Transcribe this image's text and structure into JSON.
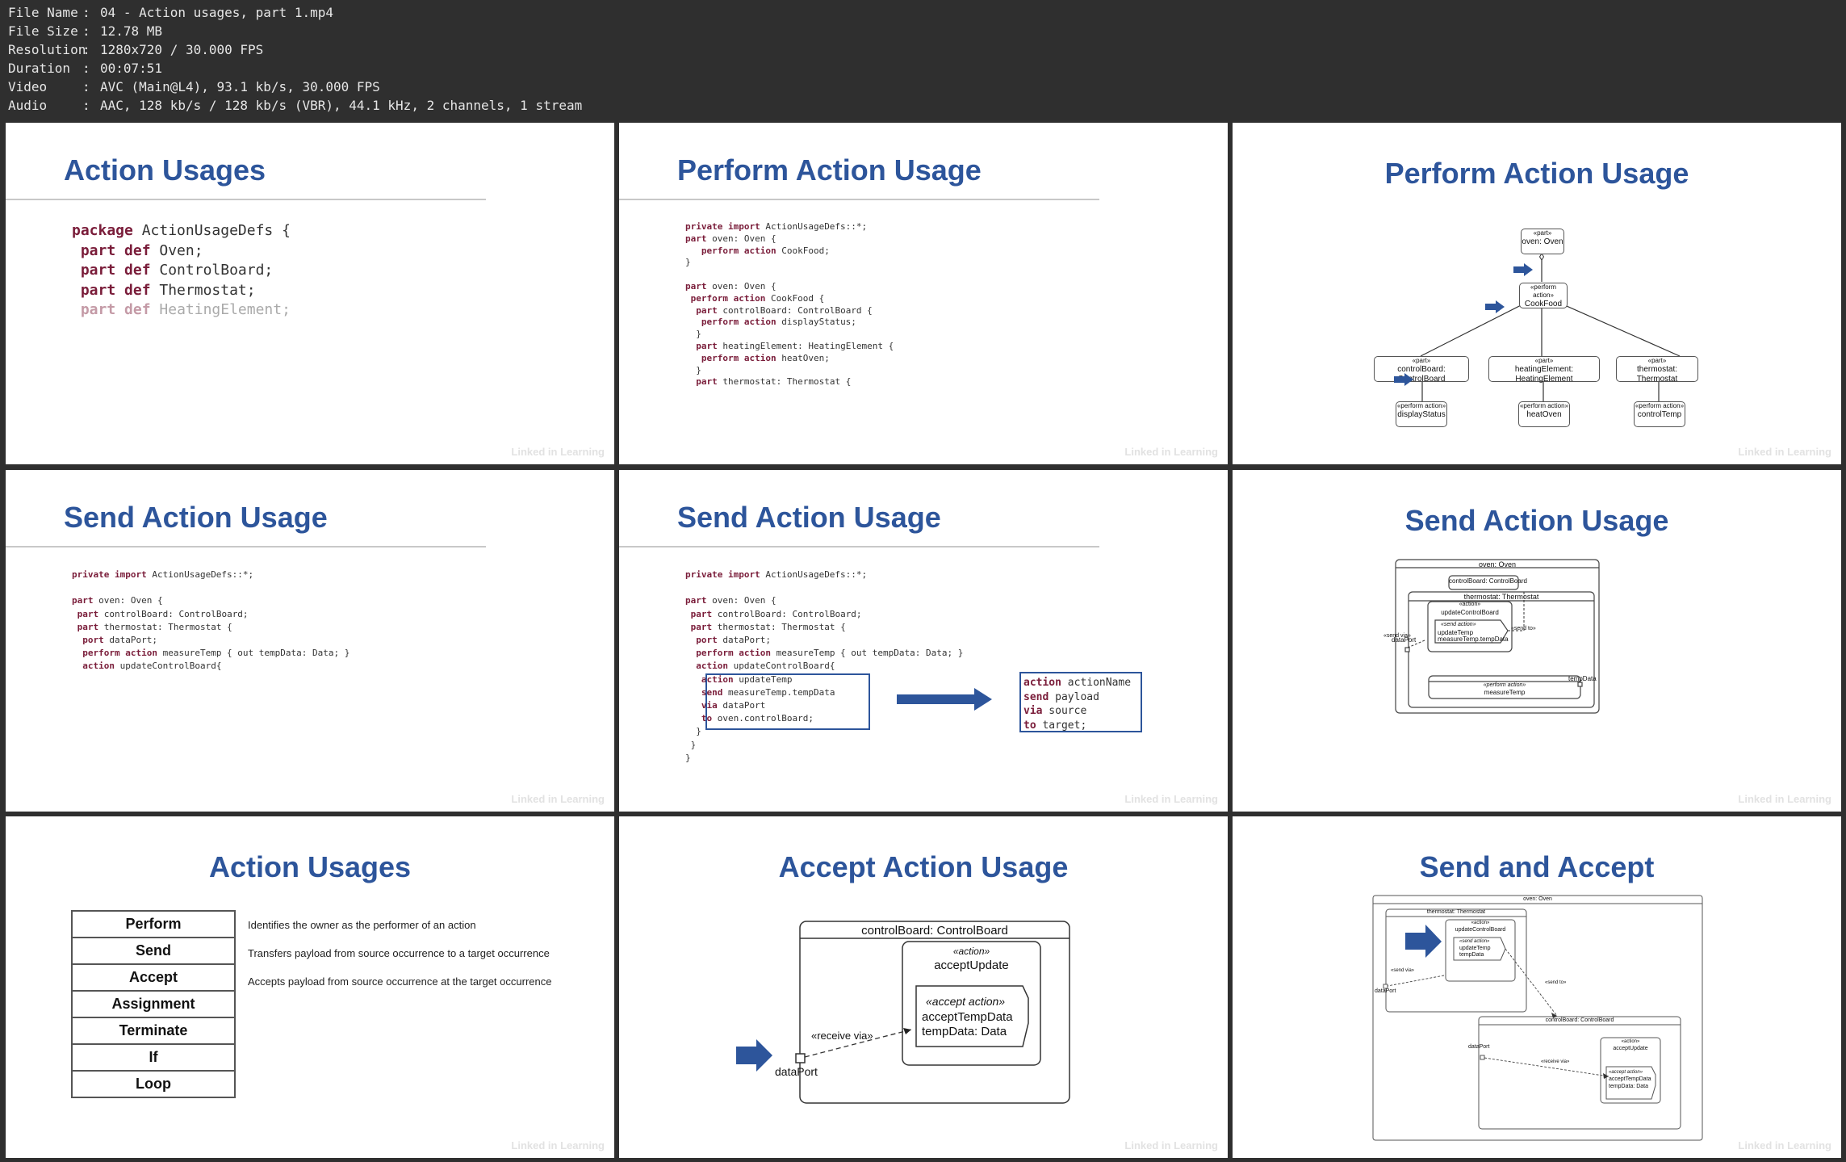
{
  "file_info": [
    {
      "key": "File Name",
      "value": "04 - Action usages, part 1.mp4"
    },
    {
      "key": "File Size",
      "value": "12.78 MB"
    },
    {
      "key": "Resolution",
      "value": "1280x720 / 30.000 FPS"
    },
    {
      "key": "Duration",
      "value": "00:07:51"
    },
    {
      "key": "Video",
      "value": "AVC (Main@L4), 93.1 kb/s, 30.000 FPS"
    },
    {
      "key": "Audio",
      "value": "AAC, 128 kb/s / 128 kb/s (VBR), 44.1 kHz, 2 channels, 1 stream"
    }
  ],
  "watermark": "Linked in Learning",
  "slides": {
    "s1": {
      "title": "Action Usages"
    },
    "s2": {
      "title": "Perform Action Usage"
    },
    "s3": {
      "title": "Perform Action Usage",
      "nodes": {
        "oven": {
          "st": "«part»",
          "nm": "oven: Oven"
        },
        "cook": {
          "st": "«perform action»",
          "nm": "CookFood"
        },
        "cb": {
          "st": "«part»",
          "nm": "controlBoard: ControlBoard"
        },
        "he": {
          "st": "«part»",
          "nm": "heatingElement: HeatingElement"
        },
        "th": {
          "st": "«part»",
          "nm": "thermostat: Thermostat"
        },
        "ds": {
          "st": "«perform action»",
          "nm": "displayStatus"
        },
        "ho": {
          "st": "«perform action»",
          "nm": "heatOven"
        },
        "ct": {
          "st": "«perform action»",
          "nm": "controlTemp"
        }
      }
    },
    "s4": {
      "title": "Send Action Usage"
    },
    "s5": {
      "title": "Send Action Usage"
    },
    "s6": {
      "title": "Send Action Usage",
      "labels": {
        "oven": "oven: Oven",
        "cb": "controlBoard: ControlBoard",
        "th": "thermostat: Thermostat",
        "act_st": "«action»",
        "act_nm": "updateControlBoard",
        "send_st": "«send action»",
        "send_1": "updateTemp",
        "send_2": "measureTemp.tempData",
        "send_via": "«send via»",
        "send_to": "«send to»",
        "dataport": "dataPort",
        "perf_st": "«perform action»",
        "perf_nm": "measureTemp",
        "tempdata": "tempData"
      }
    },
    "s7": {
      "title": "Action Usages",
      "rows": [
        {
          "name": "Perform",
          "desc": "Identifies the owner as the performer of an action"
        },
        {
          "name": "Send",
          "desc": "Transfers payload from source occurrence to a target occurrence"
        },
        {
          "name": "Accept",
          "desc": "Accepts payload from source occurrence at the target occurrence"
        },
        {
          "name": "Assignment",
          "desc": ""
        },
        {
          "name": "Terminate",
          "desc": ""
        },
        {
          "name": "If",
          "desc": ""
        },
        {
          "name": "Loop",
          "desc": ""
        }
      ]
    },
    "s8": {
      "title": "Accept Action Usage",
      "labels": {
        "cb": "controlBoard: ControlBoard",
        "act_st": "«action»",
        "act_nm": "acceptUpdate",
        "acc_st": "«accept action»",
        "acc_1": "acceptTempData",
        "acc_2": "tempData: Data",
        "recv": "«receive via»",
        "dataport": "dataPort"
      }
    },
    "s9": {
      "title": "Send and Accept",
      "labels": {
        "oven": "oven: Oven",
        "th": "thermostat: Thermostat",
        "act_st": "«action»",
        "act_nm": "updateControlBoard",
        "send_st": "«send action»",
        "send_1": "updateTemp",
        "send_2": "tempData",
        "send_via": "«send via»",
        "send_to": "«send to»",
        "dataport": "dataPort",
        "cb": "controlBoard: ControlBoard",
        "dataport2": "dataPort",
        "recv": "«receive via»",
        "acc_act_st": "«action»",
        "acc_act_nm": "acceptUpdate",
        "acc_st": "«accept action»",
        "acc_1": "acceptTempData",
        "acc_2": "tempData: Data"
      }
    }
  },
  "colors": {
    "title": "#2d559b",
    "keyword": "#7a1d3a",
    "arrow": "#2d559b",
    "header_bg": "#2f2f2f"
  }
}
